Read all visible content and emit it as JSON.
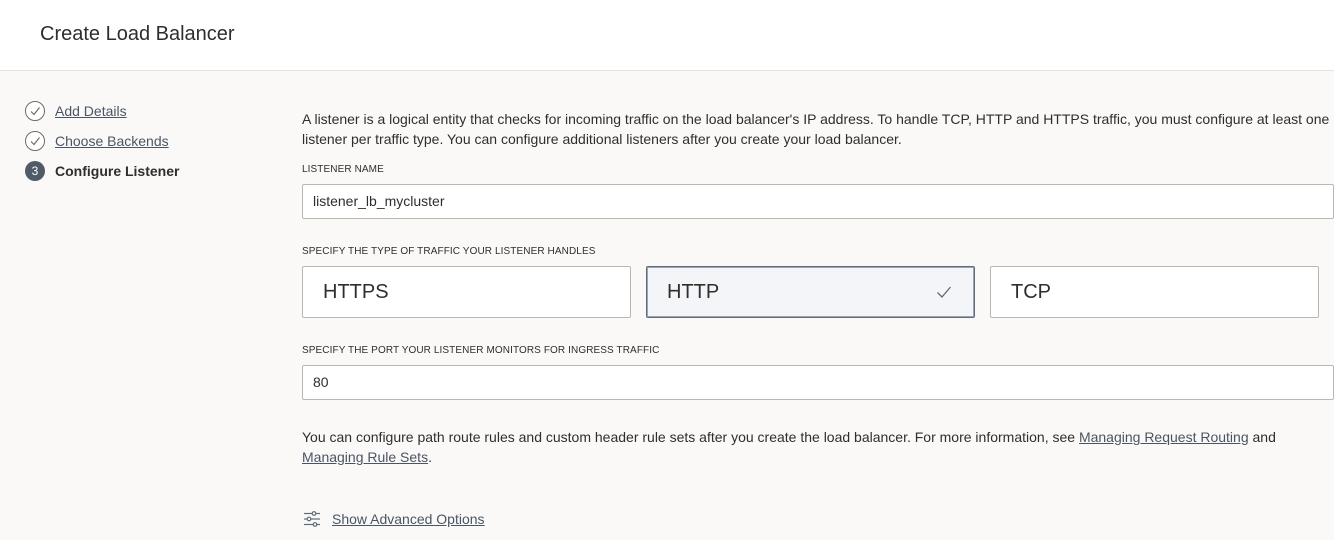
{
  "header": {
    "title": "Create Load Balancer"
  },
  "steps": [
    {
      "number": "1",
      "label": "Add Details",
      "status": "done"
    },
    {
      "number": "2",
      "label": "Choose Backends",
      "status": "done"
    },
    {
      "number": "3",
      "label": "Configure Listener",
      "status": "current"
    }
  ],
  "main": {
    "intro": "A listener is a logical entity that checks for incoming traffic on the load balancer's IP address. To handle TCP, HTTP and HTTPS traffic, you must configure at least one listener per traffic type. You can configure additional listeners after you create your load balancer.",
    "listener_name": {
      "label": "LISTENER NAME",
      "value": "listener_lb_mycluster"
    },
    "traffic_type": {
      "label": "SPECIFY THE TYPE OF TRAFFIC YOUR LISTENER HANDLES",
      "options": [
        "HTTPS",
        "HTTP",
        "TCP"
      ],
      "selected": "HTTP"
    },
    "port": {
      "label": "SPECIFY THE PORT YOUR LISTENER MONITORS FOR INGRESS TRAFFIC",
      "value": "80"
    },
    "routing_note": {
      "text_before": "You can configure path route rules and custom header rule sets after you create the load balancer. For more information, see ",
      "link1": "Managing Request Routing",
      "text_middle": " and ",
      "link2": "Managing Rule Sets",
      "text_after": "."
    },
    "advanced": {
      "label": "Show Advanced Options",
      "icon": "sliders-icon"
    }
  },
  "colors": {
    "link": "#4a5563",
    "text": "#312d2a",
    "background": "#fbf9f8",
    "selected_tile": "#f3f5f8",
    "step_current": "#4f5b66"
  }
}
